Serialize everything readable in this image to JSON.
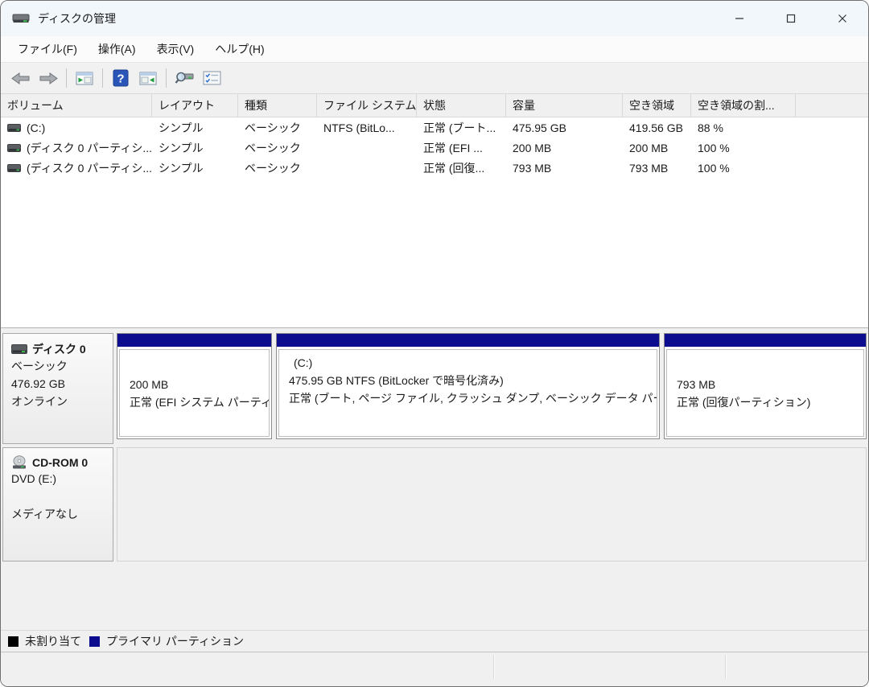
{
  "window": {
    "title": "ディスクの管理"
  },
  "menu": {
    "items": [
      "ファイル(F)",
      "操作(A)",
      "表示(V)",
      "ヘルプ(H)"
    ]
  },
  "toolbar": {
    "icons": [
      "back",
      "forward",
      "show-console-tree",
      "help",
      "show-action-pane",
      "properties-magnifier",
      "customize-view"
    ]
  },
  "volume_table": {
    "columns": [
      "ボリューム",
      "レイアウト",
      "種類",
      "ファイル システム",
      "状態",
      "容量",
      "空き領域",
      "空き領域の割..."
    ],
    "rows": [
      {
        "volume": "(C:)",
        "layout": "シンプル",
        "type": "ベーシック",
        "file_system": "NTFS (BitLo...",
        "status": "正常 (ブート...",
        "capacity": "475.95 GB",
        "free_space": "419.56 GB",
        "percent_free": "88 %"
      },
      {
        "volume": "(ディスク 0 パーティシ...",
        "layout": "シンプル",
        "type": "ベーシック",
        "file_system": "",
        "status": "正常 (EFI ...",
        "capacity": "200 MB",
        "free_space": "200 MB",
        "percent_free": "100 %"
      },
      {
        "volume": "(ディスク 0 パーティシ...",
        "layout": "シンプル",
        "type": "ベーシック",
        "file_system": "",
        "status": "正常 (回復...",
        "capacity": "793 MB",
        "free_space": "793 MB",
        "percent_free": "100 %"
      }
    ]
  },
  "disk0": {
    "name": "ディスク 0",
    "type": "ベーシック",
    "size": "476.92 GB",
    "status": "オンライン",
    "partitions": [
      {
        "label": "",
        "size_line": "200 MB",
        "status_line": "正常 (EFI システム パーティ"
      },
      {
        "label": "(C:)",
        "size_line": "475.95 GB NTFS (BitLocker で暗号化済み)",
        "status_line": "正常 (ブート, ページ ファイル, クラッシュ ダンプ, ベーシック データ パーティ"
      },
      {
        "label": "",
        "size_line": "793 MB",
        "status_line": "正常 (回復パーティション)"
      }
    ]
  },
  "cdrom": {
    "name": "CD-ROM 0",
    "drive": "DVD (E:)",
    "media_status": "メディアなし"
  },
  "legend": {
    "items": [
      {
        "label": "未割り当て",
        "color": "#000000"
      },
      {
        "label": "プライマリ パーティション",
        "color": "#0c0c8e"
      }
    ]
  },
  "colors": {
    "primary_partition": "#0c0c8e",
    "unallocated": "#000000",
    "titlebar_bg": "#f2f7fc"
  }
}
